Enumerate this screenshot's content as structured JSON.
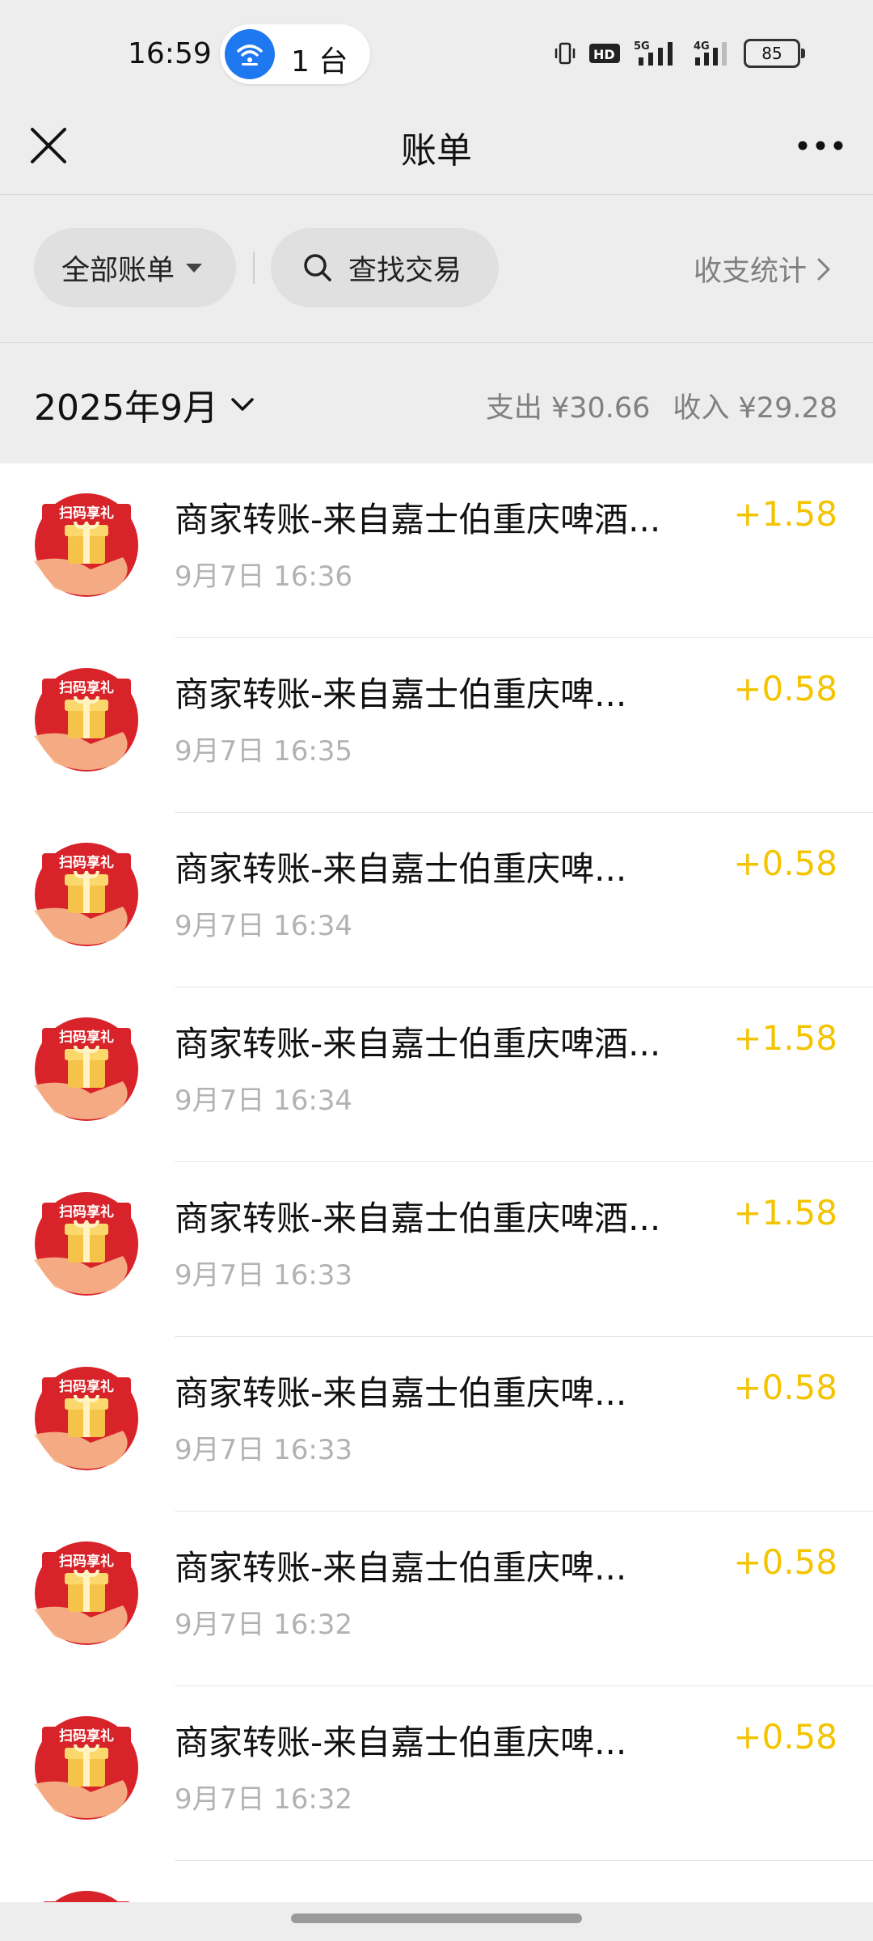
{
  "status_bar": {
    "time": "16:59",
    "device_count": "1 台",
    "network_tags": [
      "HD",
      "5G",
      "4G"
    ],
    "battery": "85"
  },
  "header": {
    "title": "账单",
    "close_icon": "close-icon",
    "more_icon": "more-icon"
  },
  "filters": {
    "all_bills": "全部账单",
    "search": "查找交易",
    "stats": "收支统计"
  },
  "month": {
    "label": "2025年9月",
    "expense": "支出 ¥30.66",
    "income": "收入 ¥29.28"
  },
  "transactions": [
    {
      "title": "商家转账-来自嘉士伯重庆啤酒...",
      "time": "9月7日 16:36",
      "amount": "+1.58"
    },
    {
      "title": "商家转账-来自嘉士伯重庆啤...",
      "time": "9月7日 16:35",
      "amount": "+0.58"
    },
    {
      "title": "商家转账-来自嘉士伯重庆啤...",
      "time": "9月7日 16:34",
      "amount": "+0.58"
    },
    {
      "title": "商家转账-来自嘉士伯重庆啤酒...",
      "time": "9月7日 16:34",
      "amount": "+1.58"
    },
    {
      "title": "商家转账-来自嘉士伯重庆啤酒...",
      "time": "9月7日 16:33",
      "amount": "+1.58"
    },
    {
      "title": "商家转账-来自嘉士伯重庆啤...",
      "time": "9月7日 16:33",
      "amount": "+0.58"
    },
    {
      "title": "商家转账-来自嘉士伯重庆啤...",
      "time": "9月7日 16:32",
      "amount": "+0.58"
    },
    {
      "title": "商家转账-来自嘉士伯重庆啤...",
      "time": "9月7日 16:32",
      "amount": "+0.58"
    }
  ],
  "avatar_badge": "扫码享礼",
  "colors": {
    "income_amount": "#f5c400",
    "avatar_red": "#d8232a",
    "pill_blue": "#1e78f0"
  }
}
